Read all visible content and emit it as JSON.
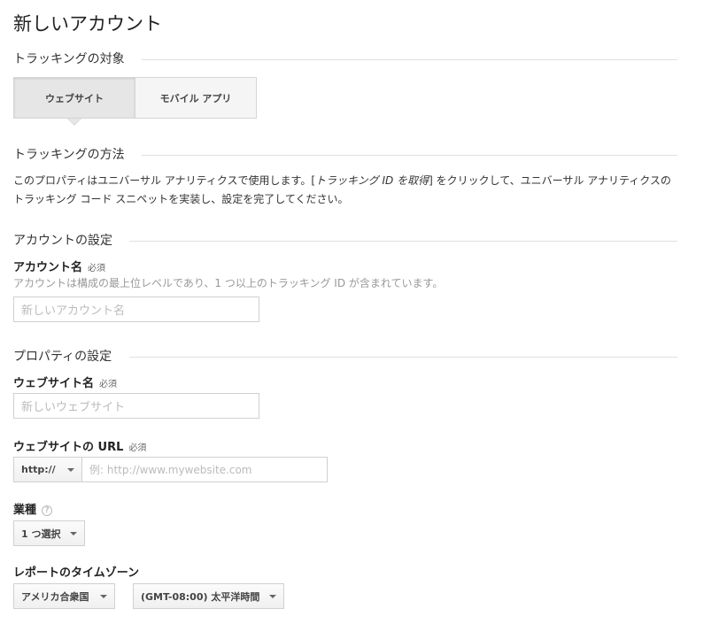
{
  "page_title": "新しいアカウント",
  "tracking_target": {
    "heading": "トラッキングの対象",
    "options": [
      {
        "label": "ウェブサイト",
        "selected": true
      },
      {
        "label": "モバイル アプリ",
        "selected": false
      }
    ]
  },
  "tracking_method": {
    "heading": "トラッキングの方法",
    "text_part1": "このプロパティはユニバーサル アナリティクスで使用します。[",
    "text_em": "トラッキング ID を取得",
    "text_part2": "] をクリックして、ユニバーサル アナリティクスのトラッキング コード スニペットを実装し、設定を完了してください。"
  },
  "account_settings": {
    "heading": "アカウントの設定",
    "account_name_label": "アカウント名",
    "required": "必須",
    "account_name_help": "アカウントは構成の最上位レベルであり、1 つ以上のトラッキング ID が含まれています。",
    "account_name_placeholder": "新しいアカウント名"
  },
  "property_settings": {
    "heading": "プロパティの設定",
    "website_name_label": "ウェブサイト名",
    "required": "必須",
    "website_name_placeholder": "新しいウェブサイト",
    "website_url_label": "ウェブサイトの URL",
    "url_protocol": "http://",
    "url_placeholder": "例: http://www.mywebsite.com",
    "industry_label": "業種",
    "industry_help_icon": "?",
    "industry_value": "1 つ選択",
    "timezone_label": "レポートのタイムゾーン",
    "timezone_country": "アメリカ合衆国",
    "timezone_value": "(GMT-08:00) 太平洋時間"
  },
  "colors": {
    "rule": "#e0e0e0",
    "segment_active": "#e6e6e6",
    "segment_inactive": "#f5f5f5"
  }
}
